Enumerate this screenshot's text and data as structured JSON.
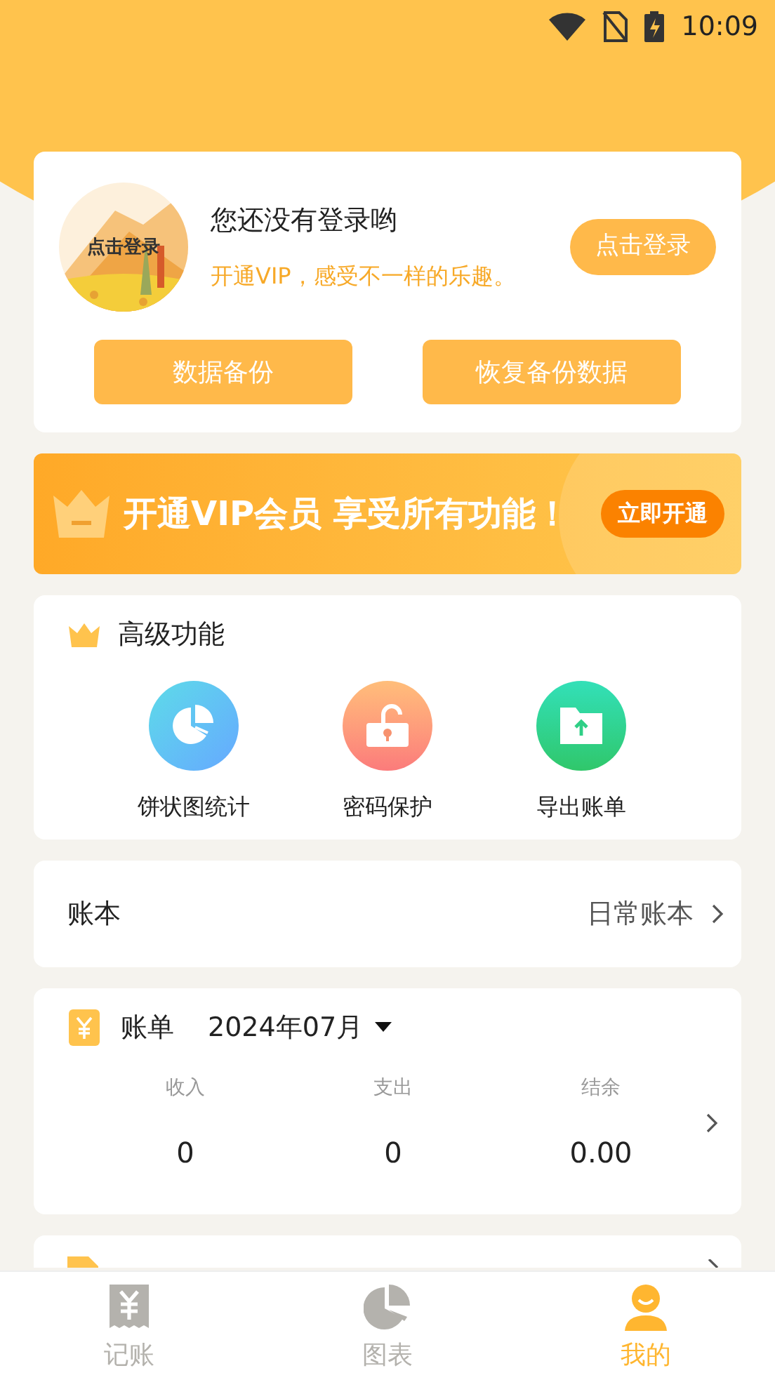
{
  "status_bar": {
    "time": "10:09"
  },
  "profile": {
    "avatar_label": "点击登录",
    "title": "您还没有登录哟",
    "subtitle": "开通VIP，感受不一样的乐趣。",
    "login_button": "点击登录",
    "actions": [
      "数据备份",
      "恢复备份数据"
    ]
  },
  "vip_banner": {
    "text": "开通VIP会员 享受所有功能！",
    "button": "立即开通"
  },
  "features": {
    "title": "高级功能",
    "items": [
      {
        "kind": "pie",
        "label": "饼状图统计"
      },
      {
        "kind": "lock",
        "label": "密码保护"
      },
      {
        "kind": "export",
        "label": "导出账单"
      }
    ]
  },
  "ledger": {
    "label": "账本",
    "value": "日常账本"
  },
  "bill": {
    "title": "账单",
    "month": "2024年07月",
    "columns": [
      {
        "label": "收入",
        "value": "0"
      },
      {
        "label": "支出",
        "value": "0"
      },
      {
        "label": "结余",
        "value": "0.00"
      }
    ]
  },
  "tabs": [
    {
      "kind": "bookkeeping",
      "label": "记账",
      "selected": false
    },
    {
      "kind": "chart",
      "label": "图表",
      "selected": false
    },
    {
      "kind": "me",
      "label": "我的",
      "selected": true
    }
  ]
}
